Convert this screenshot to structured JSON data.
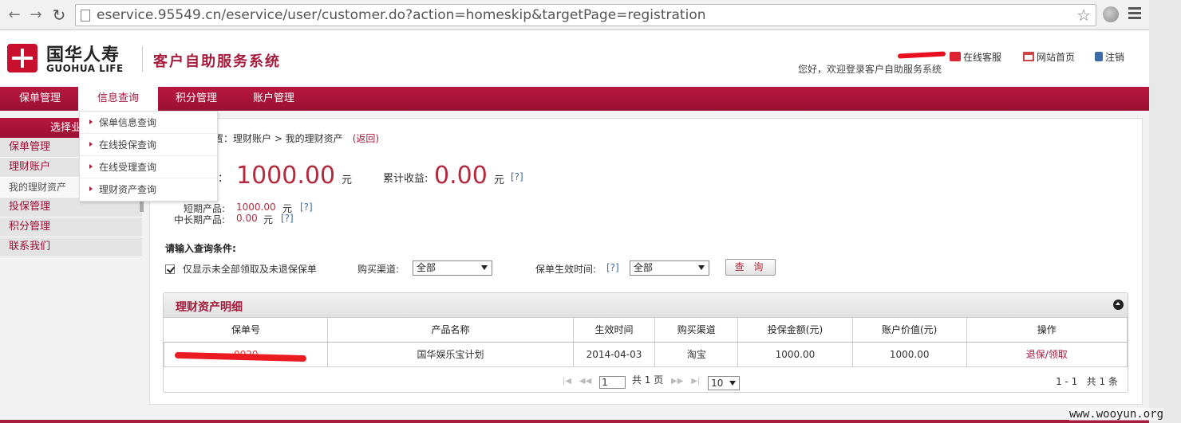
{
  "browser": {
    "url": "eservice.95549.cn/eservice/user/customer.do?action=homeskip&targetPage=registration"
  },
  "header": {
    "logo_cn": "国华人寿",
    "logo_en": "GUOHUA LIFE",
    "system_title": "客户自助服务系统",
    "links": {
      "online_service": "在线客服",
      "site_home": "网站首页",
      "logout": "注销"
    },
    "welcome": "您好，欢迎登录客户自助服务系统"
  },
  "nav": [
    "保单管理",
    "信息查询",
    "积分管理",
    "账户管理"
  ],
  "dropdown": [
    "保单信息查询",
    "在线投保查询",
    "在线受理查询",
    "理财资产查询"
  ],
  "sidebar": {
    "title": "选择业务",
    "items": [
      "保单管理",
      "理财账户",
      "我的理财资产",
      "投保管理",
      "积分管理",
      "联系我们"
    ]
  },
  "main": {
    "breadcrumb": "置：理财账户 > 我的理财资产",
    "back": "(返回)",
    "value_label": "值：",
    "value": "1000.00",
    "unit": "元",
    "income_label": "累计收益:",
    "income": "0.00",
    "help": "[?]",
    "short_label": "短期产品:",
    "short_value": "1000.00",
    "long_label": "中长期产品:",
    "long_value": "0.00",
    "cond_title": "请输入查询条件:",
    "check_label": "仅显示未全部领取及未退保保单",
    "channel_label": "购买渠道:",
    "channel_value": "全部",
    "effective_label": "保单生效时间:",
    "effective_value": "全部",
    "query_button": "查 询"
  },
  "detail": {
    "title": "理财资产明细",
    "columns": [
      "保单号",
      "产品名称",
      "生效时间",
      "购买渠道",
      "投保金额(元)",
      "账户价值(元)",
      "操作"
    ],
    "rows": [
      {
        "policy": "0020",
        "product": "国华娱乐宝计划",
        "date": "2014-04-03",
        "channel": "淘宝",
        "premium": "1000.00",
        "value": "1000.00",
        "action": "退保/领取"
      }
    ],
    "pager": {
      "page": "1",
      "total_text": "共 1 页",
      "size": "10",
      "count": "1 - 1   共 1 条"
    }
  },
  "watermark": "www.wooyun.org",
  "colors": {
    "brand": "#a51c3c",
    "accent_red": "#b52a3e",
    "link_blue": "#3b6ca8"
  }
}
